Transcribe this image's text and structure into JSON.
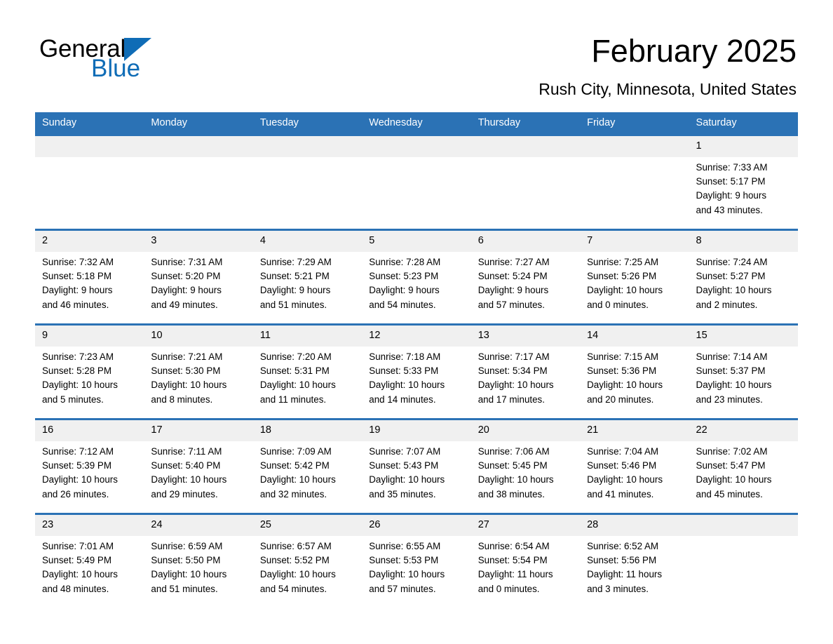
{
  "logo": {
    "word1": "General",
    "word2": "Blue",
    "triangle_color": "#0f6cb6"
  },
  "header": {
    "month_title": "February 2025",
    "location": "Rush City, Minnesota, United States"
  },
  "theme": {
    "header_blue": "#2b72b5",
    "daynum_band": "#f0f0f0",
    "text": "#000000"
  },
  "weekdays": [
    "Sunday",
    "Monday",
    "Tuesday",
    "Wednesday",
    "Thursday",
    "Friday",
    "Saturday"
  ],
  "weeks": [
    [
      {
        "day": "",
        "sunrise": "",
        "sunset": "",
        "daylight_line1": "",
        "daylight_line2": ""
      },
      {
        "day": "",
        "sunrise": "",
        "sunset": "",
        "daylight_line1": "",
        "daylight_line2": ""
      },
      {
        "day": "",
        "sunrise": "",
        "sunset": "",
        "daylight_line1": "",
        "daylight_line2": ""
      },
      {
        "day": "",
        "sunrise": "",
        "sunset": "",
        "daylight_line1": "",
        "daylight_line2": ""
      },
      {
        "day": "",
        "sunrise": "",
        "sunset": "",
        "daylight_line1": "",
        "daylight_line2": ""
      },
      {
        "day": "",
        "sunrise": "",
        "sunset": "",
        "daylight_line1": "",
        "daylight_line2": ""
      },
      {
        "day": "1",
        "sunrise": "Sunrise: 7:33 AM",
        "sunset": "Sunset: 5:17 PM",
        "daylight_line1": "Daylight: 9 hours",
        "daylight_line2": "and 43 minutes."
      }
    ],
    [
      {
        "day": "2",
        "sunrise": "Sunrise: 7:32 AM",
        "sunset": "Sunset: 5:18 PM",
        "daylight_line1": "Daylight: 9 hours",
        "daylight_line2": "and 46 minutes."
      },
      {
        "day": "3",
        "sunrise": "Sunrise: 7:31 AM",
        "sunset": "Sunset: 5:20 PM",
        "daylight_line1": "Daylight: 9 hours",
        "daylight_line2": "and 49 minutes."
      },
      {
        "day": "4",
        "sunrise": "Sunrise: 7:29 AM",
        "sunset": "Sunset: 5:21 PM",
        "daylight_line1": "Daylight: 9 hours",
        "daylight_line2": "and 51 minutes."
      },
      {
        "day": "5",
        "sunrise": "Sunrise: 7:28 AM",
        "sunset": "Sunset: 5:23 PM",
        "daylight_line1": "Daylight: 9 hours",
        "daylight_line2": "and 54 minutes."
      },
      {
        "day": "6",
        "sunrise": "Sunrise: 7:27 AM",
        "sunset": "Sunset: 5:24 PM",
        "daylight_line1": "Daylight: 9 hours",
        "daylight_line2": "and 57 minutes."
      },
      {
        "day": "7",
        "sunrise": "Sunrise: 7:25 AM",
        "sunset": "Sunset: 5:26 PM",
        "daylight_line1": "Daylight: 10 hours",
        "daylight_line2": "and 0 minutes."
      },
      {
        "day": "8",
        "sunrise": "Sunrise: 7:24 AM",
        "sunset": "Sunset: 5:27 PM",
        "daylight_line1": "Daylight: 10 hours",
        "daylight_line2": "and 2 minutes."
      }
    ],
    [
      {
        "day": "9",
        "sunrise": "Sunrise: 7:23 AM",
        "sunset": "Sunset: 5:28 PM",
        "daylight_line1": "Daylight: 10 hours",
        "daylight_line2": "and 5 minutes."
      },
      {
        "day": "10",
        "sunrise": "Sunrise: 7:21 AM",
        "sunset": "Sunset: 5:30 PM",
        "daylight_line1": "Daylight: 10 hours",
        "daylight_line2": "and 8 minutes."
      },
      {
        "day": "11",
        "sunrise": "Sunrise: 7:20 AM",
        "sunset": "Sunset: 5:31 PM",
        "daylight_line1": "Daylight: 10 hours",
        "daylight_line2": "and 11 minutes."
      },
      {
        "day": "12",
        "sunrise": "Sunrise: 7:18 AM",
        "sunset": "Sunset: 5:33 PM",
        "daylight_line1": "Daylight: 10 hours",
        "daylight_line2": "and 14 minutes."
      },
      {
        "day": "13",
        "sunrise": "Sunrise: 7:17 AM",
        "sunset": "Sunset: 5:34 PM",
        "daylight_line1": "Daylight: 10 hours",
        "daylight_line2": "and 17 minutes."
      },
      {
        "day": "14",
        "sunrise": "Sunrise: 7:15 AM",
        "sunset": "Sunset: 5:36 PM",
        "daylight_line1": "Daylight: 10 hours",
        "daylight_line2": "and 20 minutes."
      },
      {
        "day": "15",
        "sunrise": "Sunrise: 7:14 AM",
        "sunset": "Sunset: 5:37 PM",
        "daylight_line1": "Daylight: 10 hours",
        "daylight_line2": "and 23 minutes."
      }
    ],
    [
      {
        "day": "16",
        "sunrise": "Sunrise: 7:12 AM",
        "sunset": "Sunset: 5:39 PM",
        "daylight_line1": "Daylight: 10 hours",
        "daylight_line2": "and 26 minutes."
      },
      {
        "day": "17",
        "sunrise": "Sunrise: 7:11 AM",
        "sunset": "Sunset: 5:40 PM",
        "daylight_line1": "Daylight: 10 hours",
        "daylight_line2": "and 29 minutes."
      },
      {
        "day": "18",
        "sunrise": "Sunrise: 7:09 AM",
        "sunset": "Sunset: 5:42 PM",
        "daylight_line1": "Daylight: 10 hours",
        "daylight_line2": "and 32 minutes."
      },
      {
        "day": "19",
        "sunrise": "Sunrise: 7:07 AM",
        "sunset": "Sunset: 5:43 PM",
        "daylight_line1": "Daylight: 10 hours",
        "daylight_line2": "and 35 minutes."
      },
      {
        "day": "20",
        "sunrise": "Sunrise: 7:06 AM",
        "sunset": "Sunset: 5:45 PM",
        "daylight_line1": "Daylight: 10 hours",
        "daylight_line2": "and 38 minutes."
      },
      {
        "day": "21",
        "sunrise": "Sunrise: 7:04 AM",
        "sunset": "Sunset: 5:46 PM",
        "daylight_line1": "Daylight: 10 hours",
        "daylight_line2": "and 41 minutes."
      },
      {
        "day": "22",
        "sunrise": "Sunrise: 7:02 AM",
        "sunset": "Sunset: 5:47 PM",
        "daylight_line1": "Daylight: 10 hours",
        "daylight_line2": "and 45 minutes."
      }
    ],
    [
      {
        "day": "23",
        "sunrise": "Sunrise: 7:01 AM",
        "sunset": "Sunset: 5:49 PM",
        "daylight_line1": "Daylight: 10 hours",
        "daylight_line2": "and 48 minutes."
      },
      {
        "day": "24",
        "sunrise": "Sunrise: 6:59 AM",
        "sunset": "Sunset: 5:50 PM",
        "daylight_line1": "Daylight: 10 hours",
        "daylight_line2": "and 51 minutes."
      },
      {
        "day": "25",
        "sunrise": "Sunrise: 6:57 AM",
        "sunset": "Sunset: 5:52 PM",
        "daylight_line1": "Daylight: 10 hours",
        "daylight_line2": "and 54 minutes."
      },
      {
        "day": "26",
        "sunrise": "Sunrise: 6:55 AM",
        "sunset": "Sunset: 5:53 PM",
        "daylight_line1": "Daylight: 10 hours",
        "daylight_line2": "and 57 minutes."
      },
      {
        "day": "27",
        "sunrise": "Sunrise: 6:54 AM",
        "sunset": "Sunset: 5:54 PM",
        "daylight_line1": "Daylight: 11 hours",
        "daylight_line2": "and 0 minutes."
      },
      {
        "day": "28",
        "sunrise": "Sunrise: 6:52 AM",
        "sunset": "Sunset: 5:56 PM",
        "daylight_line1": "Daylight: 11 hours",
        "daylight_line2": "and 3 minutes."
      },
      {
        "day": "",
        "sunrise": "",
        "sunset": "",
        "daylight_line1": "",
        "daylight_line2": ""
      }
    ]
  ]
}
